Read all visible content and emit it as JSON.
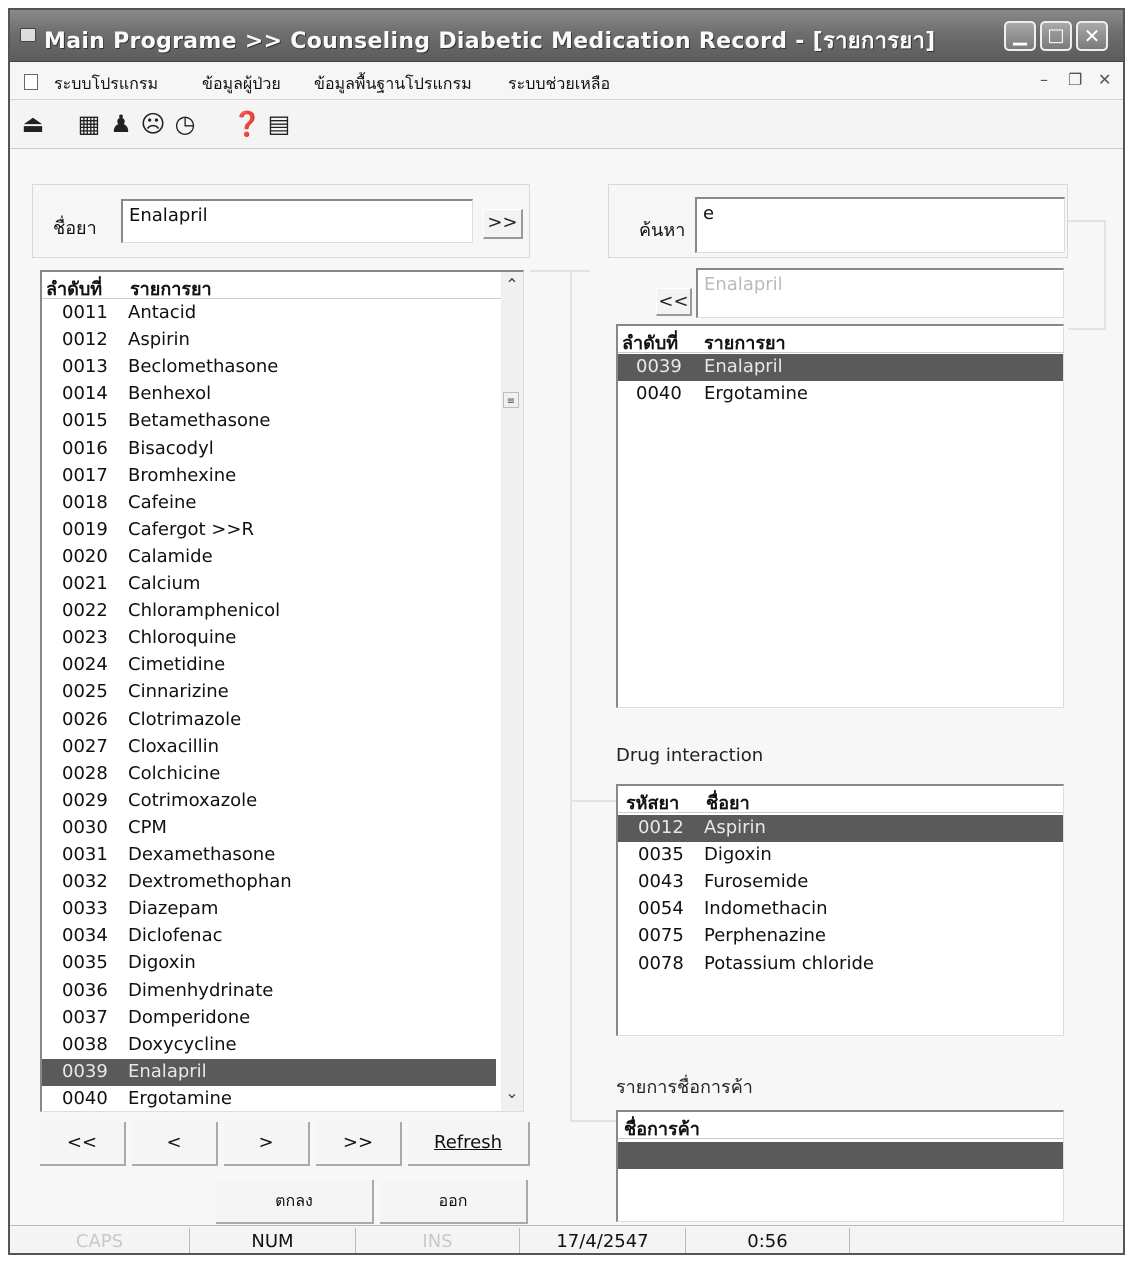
{
  "window": {
    "title": "Main Programe >> Counseling Diabetic Medication Record - [รายการยา]",
    "controls": {
      "minimize": "▁",
      "maximize": "□",
      "close": "✕"
    }
  },
  "menu": {
    "items": [
      "ระบบโปรแกรม",
      "ข้อมูลผู้ป่วย",
      "ข้อมูลพื้นฐานโปรแกรม",
      "ระบบช่วยเหลือ"
    ],
    "mdi": {
      "minimize": "–",
      "restore": "❐",
      "close": "✕"
    }
  },
  "toolbar": {
    "icons": [
      "exit-icon",
      "grid-icon",
      "people-icon",
      "face-icon",
      "clock-icon",
      "help-icon",
      "calendar-icon"
    ]
  },
  "drug_name": {
    "label": "ชื่อยา",
    "value": "Enalapril",
    "add_button": ">>"
  },
  "search": {
    "label": "ค้นหา",
    "value": "e",
    "result_value": "Enalapril",
    "back_button": "<<"
  },
  "drug_list": {
    "columns": [
      "ลำดับที่",
      "รายการยา"
    ],
    "rows": [
      [
        "0011",
        "Antacid"
      ],
      [
        "0012",
        "Aspirin"
      ],
      [
        "0013",
        "Beclomethasone"
      ],
      [
        "0014",
        "Benhexol"
      ],
      [
        "0015",
        "Betamethasone"
      ],
      [
        "0016",
        "Bisacodyl"
      ],
      [
        "0017",
        "Bromhexine"
      ],
      [
        "0018",
        "Cafeine"
      ],
      [
        "0019",
        "Cafergot >>R"
      ],
      [
        "0020",
        "Calamide"
      ],
      [
        "0021",
        "Calcium"
      ],
      [
        "0022",
        "Chloramphenicol"
      ],
      [
        "0023",
        "Chloroquine"
      ],
      [
        "0024",
        "Cimetidine"
      ],
      [
        "0025",
        "Cinnarizine"
      ],
      [
        "0026",
        "Clotrimazole"
      ],
      [
        "0027",
        "Cloxacillin"
      ],
      [
        "0028",
        "Colchicine"
      ],
      [
        "0029",
        "Cotrimoxazole"
      ],
      [
        "0030",
        "CPM"
      ],
      [
        "0031",
        "Dexamethasone"
      ],
      [
        "0032",
        "Dextromethophan"
      ],
      [
        "0033",
        "Diazepam"
      ],
      [
        "0034",
        "Diclofenac"
      ],
      [
        "0035",
        "Digoxin"
      ],
      [
        "0036",
        "Dimenhydrinate"
      ],
      [
        "0037",
        "Domperidone"
      ],
      [
        "0038",
        "Doxycycline"
      ],
      [
        "0039",
        "Enalapril"
      ],
      [
        "0040",
        "Ergotamine"
      ]
    ],
    "selected_index": 28
  },
  "search_results": {
    "columns": [
      "ลำดับที่",
      "รายการยา"
    ],
    "rows": [
      [
        "0039",
        "Enalapril"
      ],
      [
        "0040",
        "Ergotamine"
      ]
    ],
    "selected_index": 0
  },
  "interaction": {
    "title": "Drug interaction",
    "columns": [
      "รหัสยา",
      "ชื่อยา"
    ],
    "rows": [
      [
        "0012",
        "Aspirin"
      ],
      [
        "0035",
        "Digoxin"
      ],
      [
        "0043",
        "Furosemide"
      ],
      [
        "0054",
        "Indomethacin"
      ],
      [
        "0075",
        "Perphenazine"
      ],
      [
        "0078",
        "Potassium chloride"
      ]
    ],
    "selected_index": 0
  },
  "trade_names": {
    "title": "รายการชื่อการค้า",
    "columns": [
      "ชื่อการค้า"
    ]
  },
  "nav": {
    "first": "<<",
    "prev": "<",
    "next": ">",
    "last": ">>",
    "refresh": "Refresh"
  },
  "actions": {
    "ok": "ตกลง",
    "exit": "ออก"
  },
  "status": {
    "caps": "CAPS",
    "num": "NUM",
    "ins": "INS",
    "date": "17/4/2547",
    "time": "0:56"
  }
}
